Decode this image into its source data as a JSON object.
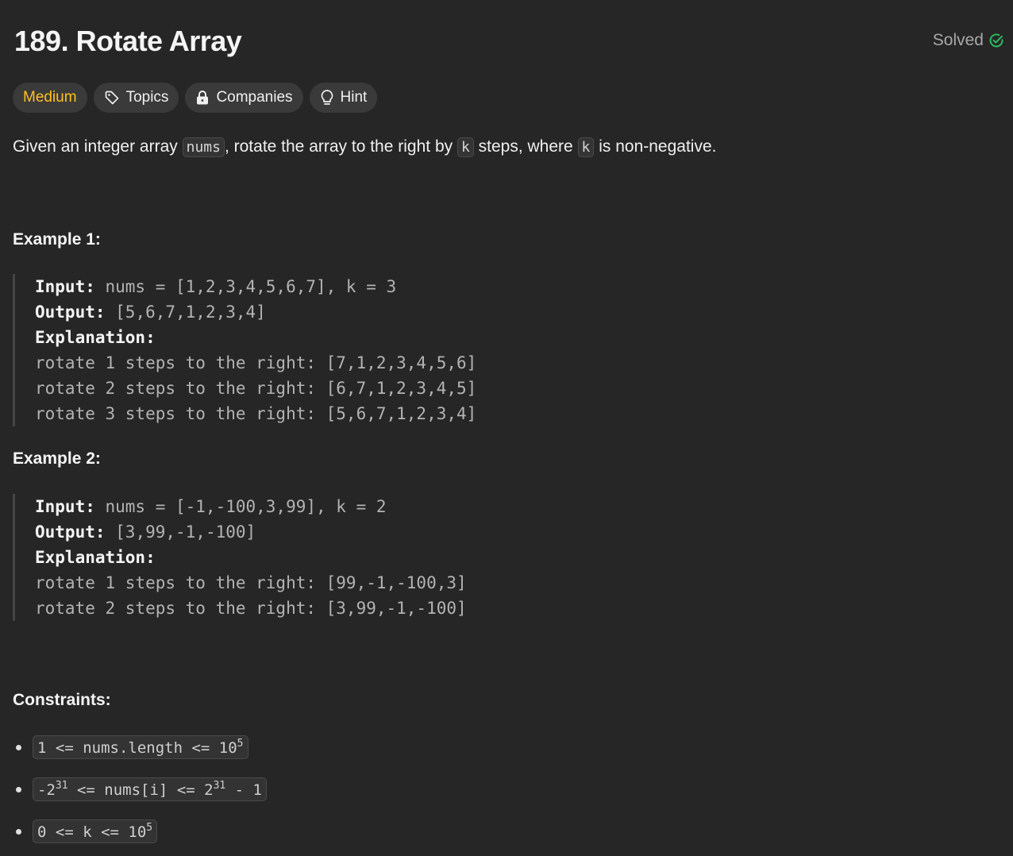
{
  "problem": {
    "title": "189. Rotate Array",
    "status": "Solved",
    "colors": {
      "solved": "#2cbb5d",
      "medium": "#ffc01e"
    }
  },
  "tags": {
    "difficulty": "Medium",
    "topics": "Topics",
    "companies": "Companies",
    "hint": "Hint"
  },
  "description": {
    "text1": "Given an integer array ",
    "code1": "nums",
    "text2": ", rotate the array to the right by ",
    "code2": "k",
    "text3": " steps, where ",
    "code3": "k",
    "text4": " is non-negative."
  },
  "example1": {
    "heading": "Example 1:",
    "input_label": "Input:",
    "input_value": " nums = [1,2,3,4,5,6,7], k = 3",
    "output_label": "Output:",
    "output_value": " [5,6,7,1,2,3,4]",
    "explanation_label": "Explanation:",
    "lines": [
      "rotate 1 steps to the right: [7,1,2,3,4,5,6]",
      "rotate 2 steps to the right: [6,7,1,2,3,4,5]",
      "rotate 3 steps to the right: [5,6,7,1,2,3,4]"
    ]
  },
  "example2": {
    "heading": "Example 2:",
    "input_label": "Input:",
    "input_value": " nums = [-1,-100,3,99], k = 2",
    "output_label": "Output:",
    "output_value": " [3,99,-1,-100]",
    "explanation_label": "Explanation:",
    "lines": [
      "rotate 1 steps to the right: [99,-1,-100,3]",
      "rotate 2 steps to the right: [3,99,-1,-100]"
    ]
  },
  "constraints": {
    "heading": "Constraints:",
    "c1": {
      "pre": "1 <= nums.length <= 10",
      "sup": "5",
      "post": ""
    },
    "c2": {
      "pre": "-2",
      "sup": "31",
      "mid": " <= nums[i] <= 2",
      "sup2": "31",
      "post": " - 1"
    },
    "c3": {
      "pre": "0 <= k <= 10",
      "sup": "5",
      "post": ""
    }
  }
}
